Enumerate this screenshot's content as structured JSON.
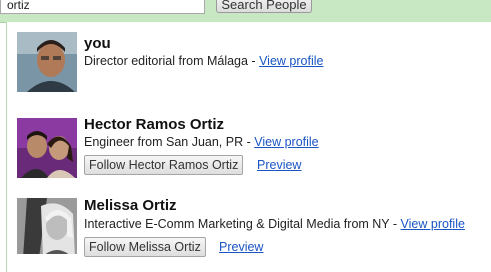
{
  "search": {
    "value": "ortiz",
    "button_label": "Search People"
  },
  "results": [
    {
      "name": "you",
      "description": "Director editorial from Málaga - ",
      "view_profile": "View profile"
    },
    {
      "name": "Hector Ramos Ortiz",
      "description": "Engineer from San Juan, PR - ",
      "view_profile": "View profile",
      "follow_label": "Follow Hector Ramos Ortiz",
      "preview_label": "Preview"
    },
    {
      "name": "Melissa Ortiz",
      "description": "Interactive E-Comm Marketing & Digital Media from NY - ",
      "view_profile": "View profile",
      "follow_label": "Follow Melissa Ortiz",
      "preview_label": "Preview"
    }
  ],
  "colors": {
    "topbar": "#c7e8c2",
    "link": "#1a55c4"
  }
}
